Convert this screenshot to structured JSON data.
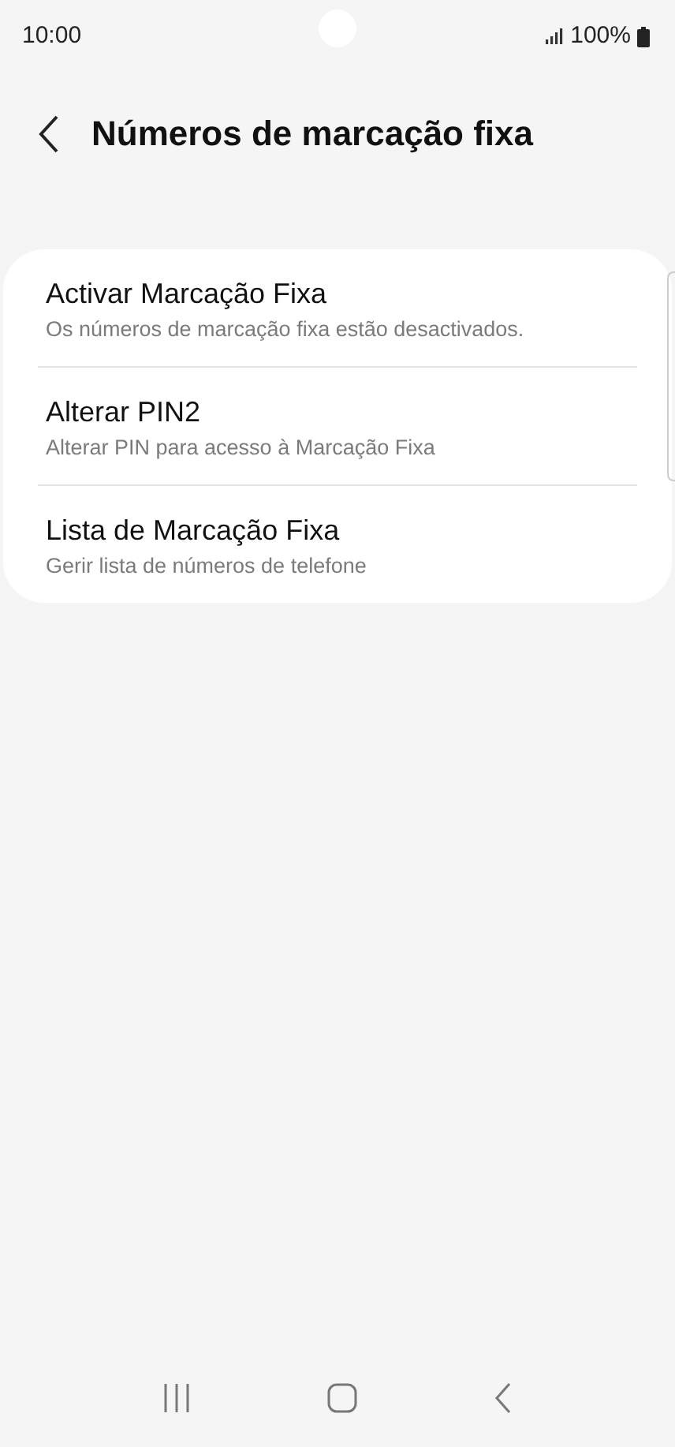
{
  "status_bar": {
    "time": "10:00",
    "battery": "100%"
  },
  "title": "Números de marcação fixa",
  "items": [
    {
      "title": "Activar Marcação Fixa",
      "subtitle": "Os números de marcação fixa estão desactivados."
    },
    {
      "title": "Alterar PIN2",
      "subtitle": "Alterar PIN para acesso à Marcação Fixa"
    },
    {
      "title": "Lista de Marcação Fixa",
      "subtitle": "Gerir lista de números de telefone"
    }
  ]
}
